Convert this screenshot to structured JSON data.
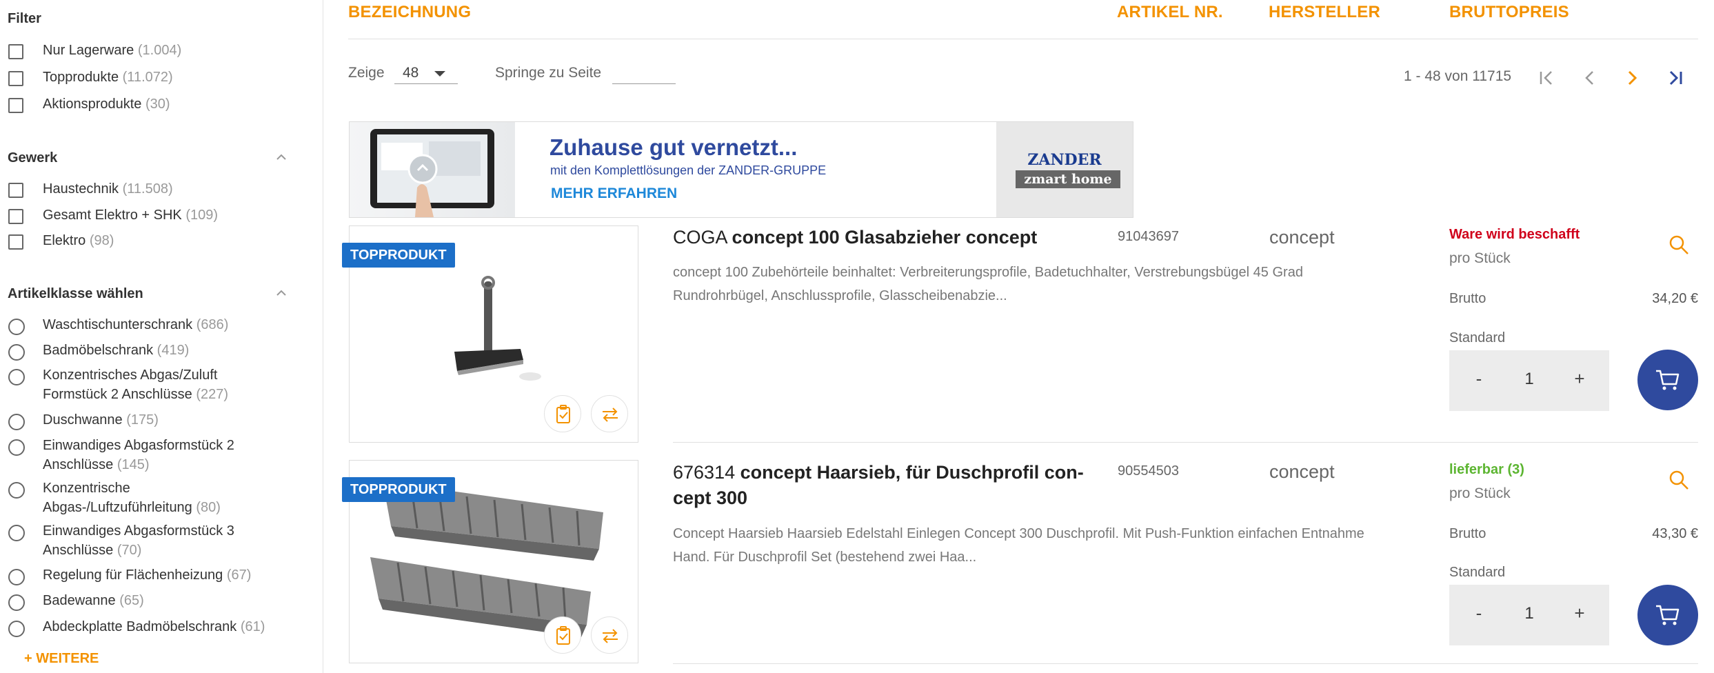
{
  "sidebar": {
    "filter": {
      "title": "Filter",
      "items": [
        {
          "label": "Nur Lagerware",
          "count": "(1.004)"
        },
        {
          "label": "Topprodukte",
          "count": "(11.072)"
        },
        {
          "label": "Aktionsprodukte",
          "count": "(30)"
        }
      ]
    },
    "gewerk": {
      "title": "Gewerk",
      "items": [
        {
          "label": "Haustechnik",
          "count": "(11.508)"
        },
        {
          "label": "Gesamt Elektro + SHK",
          "count": "(109)"
        },
        {
          "label": "Elektro",
          "count": "(98)"
        }
      ]
    },
    "artikelklasse": {
      "title": "Artikelklasse wählen",
      "items": [
        {
          "label": "Waschtischunterschrank",
          "count": "(686)"
        },
        {
          "label": "Badmöbelschrank",
          "count": "(419)"
        },
        {
          "label": "Konzentrisches Abgas/Zuluft Formstück 2 Anschlüsse",
          "count": "(227)"
        },
        {
          "label": "Duschwanne",
          "count": "(175)"
        },
        {
          "label": "Einwandiges Abgasformstück 2 Anschlüsse",
          "count": "(145)"
        },
        {
          "label": "Konzentrische Abgas-/Luftzuführleitung",
          "count": "(80)"
        },
        {
          "label": "Einwandiges Abgasformstück 3 Anschlüsse",
          "count": "(70)"
        },
        {
          "label": "Regelung für Flächenheizung",
          "count": "(67)"
        },
        {
          "label": "Badewanne",
          "count": "(65)"
        },
        {
          "label": "Abdeckplatte Badmöbelschrank",
          "count": "(61)"
        }
      ]
    },
    "more_label": "+ WEITERE"
  },
  "table_header": {
    "bezeichnung": "BEZEICHNUNG",
    "artikel_nr": "ARTIKEL NR.",
    "hersteller": "HERSTELLER",
    "bruttopreis": "BRUTTOPREIS"
  },
  "pagination": {
    "show_label": "Zeige",
    "page_size": "48",
    "jump_label": "Springe zu Seite",
    "jump_value": "",
    "range_text": "1 - 48 von 11715"
  },
  "banner": {
    "title": "Zuhause gut vernetzt...",
    "subtitle": "mit den Komplettlösungen der ZANDER-GRUPPE",
    "cta": "MEHR ERFAHREN",
    "logo_top": "ZANDER",
    "logo_bottom": "zmart home"
  },
  "products": [
    {
      "badge": "TOPPRODUKT",
      "title_prefix": "COGA",
      "title_main": "concept 100 Glasabzieher concept",
      "description": "concept 100 Zubehörteile beinhaltet: Verbreiterungsprofile, Badetuchhalter, Verstrebungsbügel 45 Grad Rundrohrbügel, Anschlussprofile, Glasscheibenabzie...",
      "article_no": "91043697",
      "manufacturer": "concept",
      "status": "Ware wird beschafft",
      "status_color": "#d0021b",
      "unit": "pro Stück",
      "brutto_label": "Brutto",
      "price": "34,20 €",
      "standard_label": "Standard",
      "qty_minus": "-",
      "qty": "1",
      "qty_plus": "+"
    },
    {
      "badge": "TOPPRODUKT",
      "title_prefix": "676314",
      "title_main": "concept Haarsieb, für Duschprofil con-cept 300",
      "description": "Concept Haarsieb Haarsieb Edelstahl Einlegen Concept 300 Duschprofil. Mit Push-Funktion einfachen Entnahme Hand. Für Duschprofil Set (bestehend zwei Haa...",
      "article_no": "90554503",
      "manufacturer": "concept",
      "status": "lieferbar (3)",
      "status_color": "#5cb531",
      "unit": "pro Stück",
      "brutto_label": "Brutto",
      "price": "43,30 €",
      "standard_label": "Standard",
      "qty_minus": "-",
      "qty": "1",
      "qty_plus": "+"
    }
  ],
  "colors": {
    "accent_orange": "#f39200",
    "primary_blue": "#2f4a9e",
    "badge_blue": "#1c6fc8"
  }
}
